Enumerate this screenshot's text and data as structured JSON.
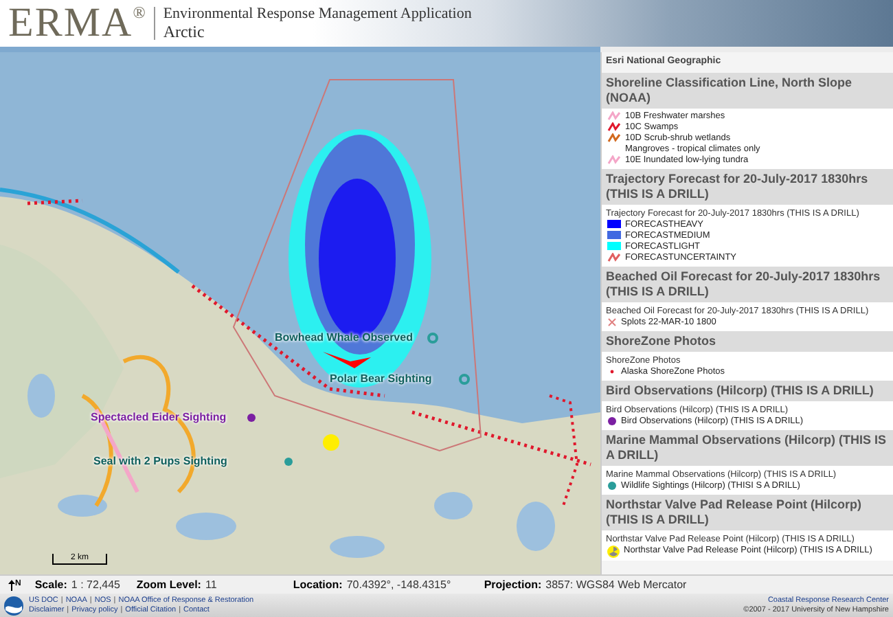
{
  "header": {
    "logo": "ERMA",
    "registered": "®",
    "app_name": "Environmental Response Management Application",
    "region": "Arctic"
  },
  "map": {
    "labels": [
      {
        "text": "Bowhead Whale Observed",
        "color": "#0e5f5c"
      },
      {
        "text": "Polar Bear Sighting",
        "color": "#0e5f5c"
      },
      {
        "text": "Spectacled Eider Sighting",
        "color": "#7b1fa2"
      },
      {
        "text": "Seal with 2 Pups Sighting",
        "color": "#0e5f5c"
      }
    ],
    "scale_bar": "2 km"
  },
  "legend": {
    "basemap": "Esri National Geographic",
    "sections": [
      {
        "title": "Shoreline Classification Line, North Slope (NOAA)",
        "entries": [
          {
            "kind": "line",
            "color": "#f4a6c8",
            "label": "10B Freshwater marshes"
          },
          {
            "kind": "line",
            "color": "#e0182c",
            "label": "10C Swamps"
          },
          {
            "kind": "line",
            "color": "#d2691e",
            "label": "10D Scrub-shrub wetlands\nMangroves - tropical climates only"
          },
          {
            "kind": "line",
            "color": "#f4a6c8",
            "label": "10E Inundated low-lying tundra"
          }
        ]
      },
      {
        "title": "Trajectory Forecast for 20-July-2017 1830hrs (THIS IS A DRILL)",
        "subtitle": "Trajectory Forecast for 20-July-2017 1830hrs (THIS IS A DRILL)",
        "entries": [
          {
            "kind": "swatch",
            "color": "#0000ff",
            "label": "FORECASTHEAVY"
          },
          {
            "kind": "swatch",
            "color": "#4169e1",
            "label": "FORECASTMEDIUM"
          },
          {
            "kind": "swatch",
            "color": "#00ffff",
            "label": "FORECASTLIGHT"
          },
          {
            "kind": "line",
            "color": "#e06060",
            "label": "FORECASTUNCERTAINTY"
          }
        ]
      },
      {
        "title": "Beached Oil Forecast for 20-July-2017 1830hrs (THIS IS A DRILL)",
        "subtitle": "Beached Oil Forecast for 20-July-2017 1830hrs (THIS IS A DRILL)",
        "entries": [
          {
            "kind": "cross",
            "color": "#e08080",
            "label": "Splots 22-MAR-10 1800"
          }
        ]
      },
      {
        "title": "ShoreZone Photos",
        "subtitle": "ShoreZone Photos",
        "entries": [
          {
            "kind": "smalldot",
            "color": "#e0182c",
            "label": "Alaska ShoreZone Photos"
          }
        ]
      },
      {
        "title": "Bird Observations (Hilcorp) (THIS IS A DRILL)",
        "subtitle": "Bird Observations (Hilcorp) (THIS IS A DRILL)",
        "entries": [
          {
            "kind": "dot",
            "color": "#7b1fa2",
            "label": "Bird Observations (Hilcorp) (THIS IS A DRILL)"
          }
        ]
      },
      {
        "title": "Marine Mammal Observations (Hilcorp) (THIS IS A DRILL)",
        "subtitle": "Marine Mammal Observations (Hilcorp) (THIS IS A DRILL)",
        "entries": [
          {
            "kind": "dot",
            "color": "#2a9d9a",
            "label": "Wildlife Sightings (Hilcorp) (THISI S A DRILL)"
          }
        ]
      },
      {
        "title": "Northstar Valve Pad Release Point (Hilcorp) (THIS IS A DRILL)",
        "subtitle": "Northstar Valve Pad Release Point (Hilcorp) (THIS IS A DRILL)",
        "entries": [
          {
            "kind": "hazard",
            "color": "#ffee00",
            "label": "Northstar Valve Pad Release Point (Hilcorp) (THIS IS A DRILL)"
          }
        ]
      }
    ]
  },
  "status_bar": [
    {
      "label": "Scale:",
      "value": "1 : 72,445"
    },
    {
      "label": "Zoom Level:",
      "value": "11"
    },
    {
      "label": "Location:",
      "value": "70.4392°, -148.4315°"
    },
    {
      "label": "Projection:",
      "value": "3857: WGS84 Web Mercator"
    }
  ],
  "north": "N",
  "footer": {
    "separator": "|",
    "left_links": [
      [
        "US DOC",
        "NOAA",
        "NOS",
        "NOAA Office of Response & Restoration"
      ],
      [
        "Disclaimer",
        "Privacy policy",
        "Official Citation",
        "Contact"
      ]
    ],
    "right_link": "Coastal Response Research Center",
    "copyright": "©2007 - 2017 University of New Hampshire"
  }
}
